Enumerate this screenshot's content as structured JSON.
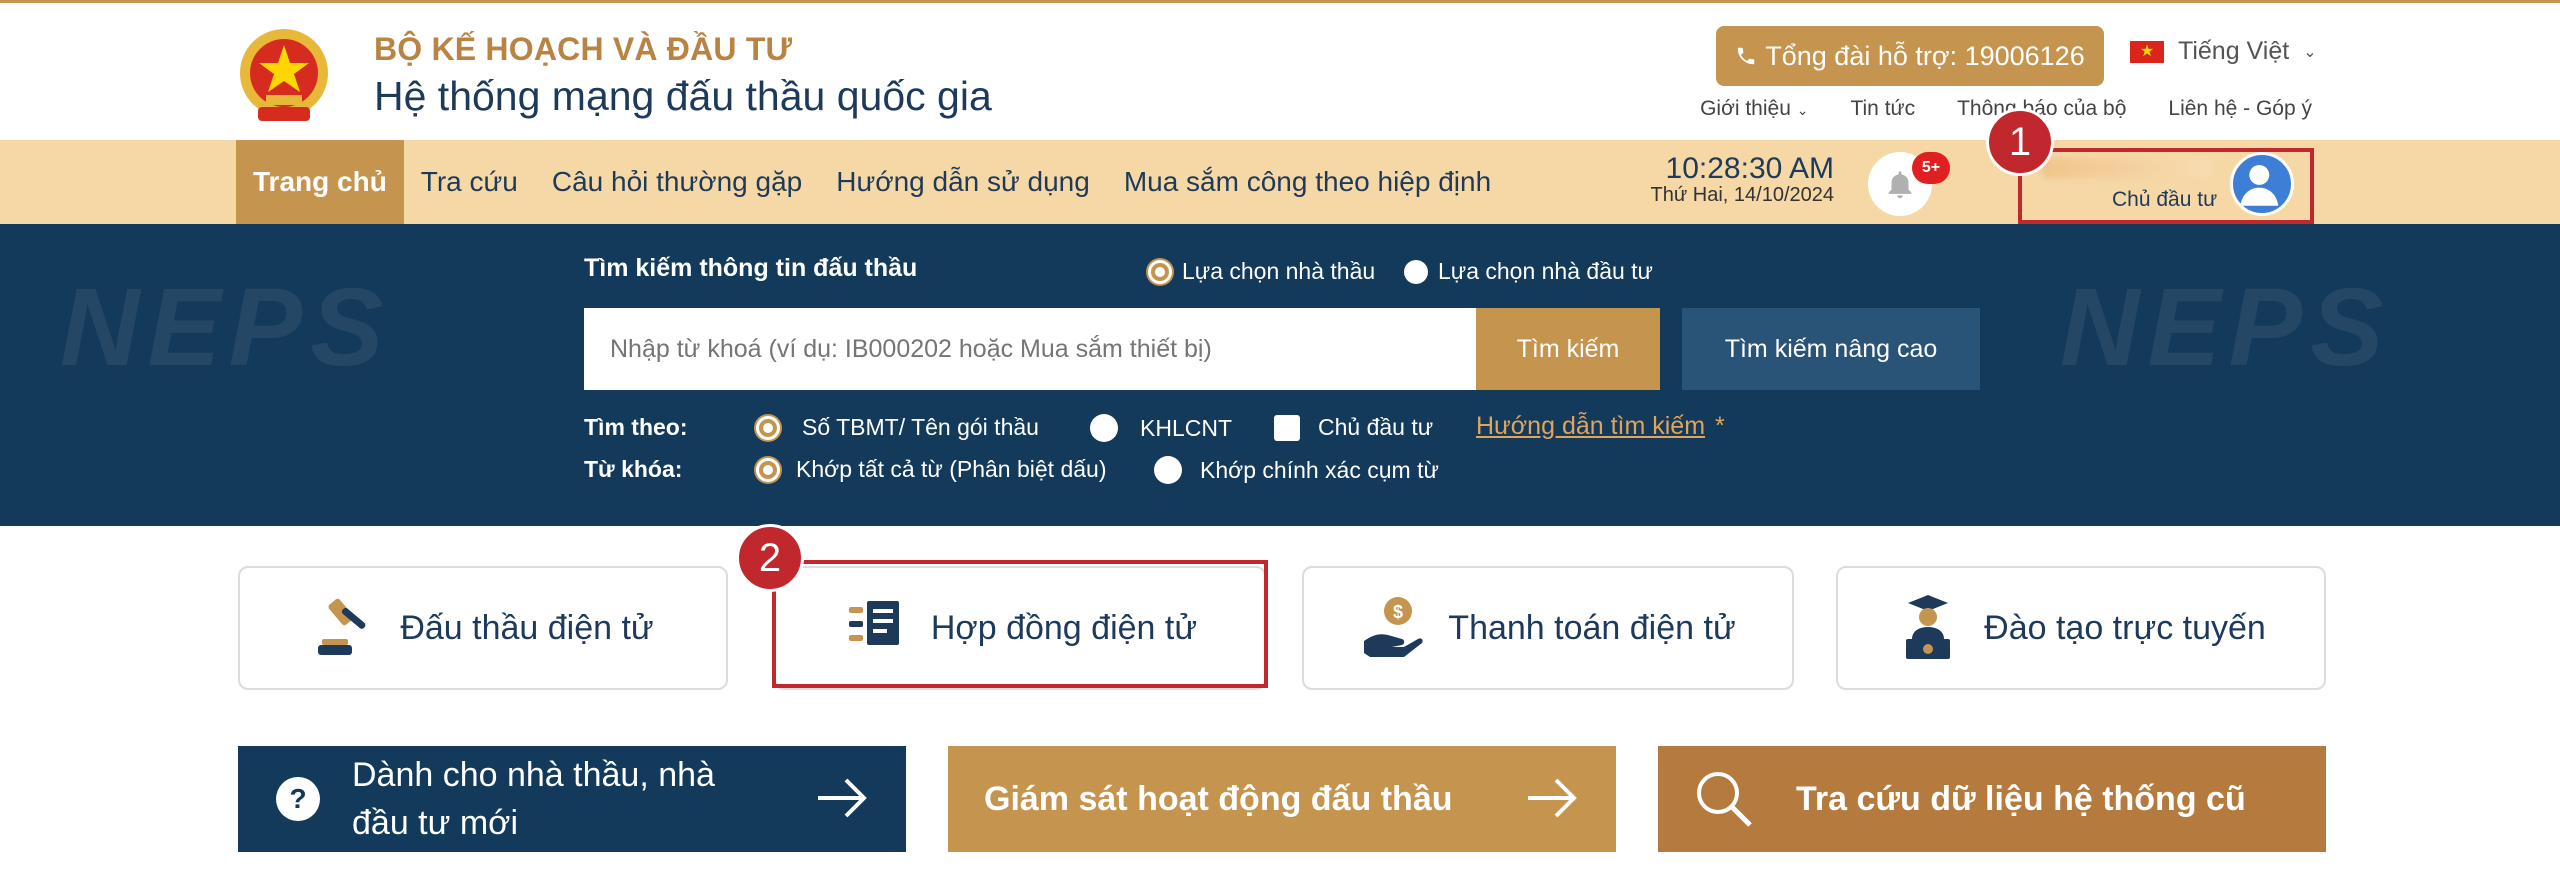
{
  "header": {
    "org_name": "BỘ KẾ HOẠCH VÀ ĐẦU TƯ",
    "system_name": "Hệ thống mạng đấu thầu quốc gia",
    "hotline": "Tổng đài hỗ trợ: 19006126",
    "language": "Tiếng Việt",
    "top_links": [
      "Giới thiệu",
      "Tin tức",
      "Thông báo của bộ",
      "Liên hệ - Góp ý"
    ]
  },
  "nav": {
    "items": [
      "Trang chủ",
      "Tra cứu",
      "Câu hỏi thường gặp",
      "Hướng dẫn sử dụng",
      "Mua sắm công theo hiệp định"
    ],
    "time": "10:28:30 AM",
    "date": "Thứ Hai, 14/10/2024",
    "notification_count": "5+",
    "user_role": "Chủ đầu tư"
  },
  "annotations": {
    "step1": "1",
    "step2": "2"
  },
  "search": {
    "title": "Tìm kiếm thông tin đấu thầu",
    "mode_options": [
      "Lựa chọn nhà thầu",
      "Lựa chọn nhà đầu tư"
    ],
    "placeholder": "Nhập từ khoá (ví dụ: IB000202 hoặc Mua sắm thiết bị)",
    "search_button": "Tìm kiếm",
    "advanced_button": "Tìm kiếm nâng cao",
    "search_by_label": "Tìm theo:",
    "search_by_options": [
      "Số TBMT/ Tên gói thầu",
      "KHLCNT",
      "Chủ đầu tư"
    ],
    "guide_link": "Hướng dẫn tìm kiếm",
    "required_mark": "*",
    "keyword_label": "Từ khóa:",
    "keyword_options": [
      "Khớp tất cả từ (Phân biệt dấu)",
      "Khớp chính xác cụm từ"
    ],
    "watermark": "NEPS"
  },
  "services": [
    {
      "label": "Đấu thầu điện tử"
    },
    {
      "label": "Hợp đồng điện tử"
    },
    {
      "label": "Thanh toán điện tử"
    },
    {
      "label": "Đào tạo trực tuyến"
    }
  ],
  "actions": {
    "newcomer_line1": "Dành cho nhà thầu, nhà",
    "newcomer_line2": "đầu tư mới",
    "monitor": "Giám sát hoạt động đấu thầu",
    "legacy": "Tra cứu dữ liệu hệ thống cũ"
  },
  "colors": {
    "navy": "#133a5a",
    "gold": "#c5944f",
    "nav_bg": "#f5d8a6",
    "highlight": "#c0282d"
  }
}
